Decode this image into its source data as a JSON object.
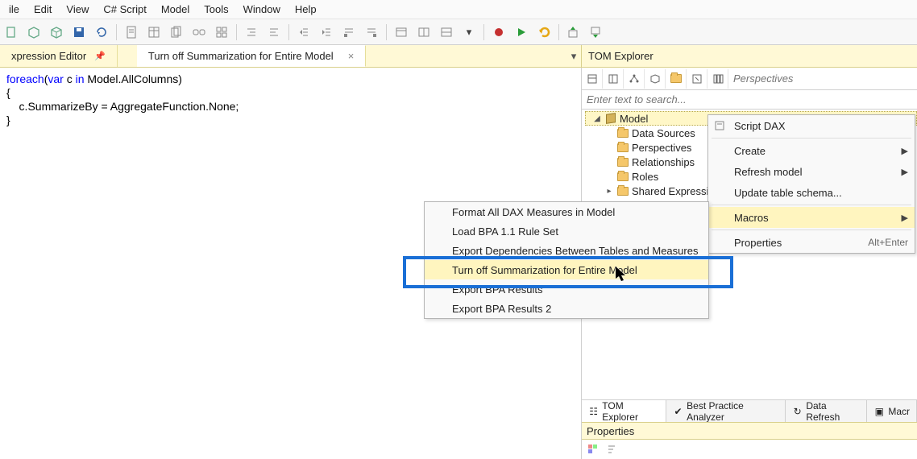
{
  "menubar": [
    "ile",
    "Edit",
    "View",
    "C# Script",
    "Model",
    "Tools",
    "Window",
    "Help"
  ],
  "tabs": {
    "left": "xpression Editor",
    "right_active": "Turn off Summarization for Entire Model"
  },
  "code": {
    "line1a": "foreach",
    "line1b": "(",
    "line1c": "var",
    "line1d": " c ",
    "line1e": "in",
    "line1f": " Model.AllColumns)",
    "line2": "{",
    "line3": "    c.SummarizeBy = AggregateFunction.None;",
    "line4": "}"
  },
  "right_panel": {
    "title": "TOM Explorer",
    "perspectives_placeholder": "Perspectives",
    "search_placeholder": "Enter text to search..."
  },
  "tree": {
    "root": "Model",
    "children": [
      "Data Sources",
      "Perspectives",
      "Relationships",
      "Roles",
      "Shared Expressio"
    ]
  },
  "ctx_right": {
    "script_dax": "Script DAX",
    "create": "Create",
    "refresh": "Refresh model",
    "update": "Update table schema...",
    "macros": "Macros",
    "properties": "Properties",
    "properties_shortcut": "Alt+Enter"
  },
  "ctx_sub": [
    "Format All DAX Measures in Model",
    "Load BPA 1.1 Rule Set",
    "Export Dependencies Between Tables and Measures",
    "Turn off Summarization for Entire Model",
    "Export BPA Results",
    "Export BPA Results 2"
  ],
  "bottom_tabs": {
    "tom": "TOM Explorer",
    "bpa": "Best Practice Analyzer",
    "refresh": "Data Refresh",
    "macro": "Macr"
  },
  "props": {
    "title": "Properties"
  }
}
